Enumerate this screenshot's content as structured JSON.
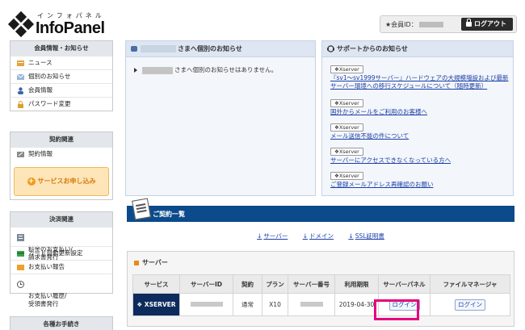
{
  "header": {
    "logo_kana": "インフォパネル",
    "logo_text": "InfoPanel",
    "member_id_label": "★会員ID：",
    "logout_label": "ログアウト"
  },
  "sidebar": {
    "section1": {
      "title": "会員情報・お知らせ",
      "items": [
        "ニュース",
        "個別のお知らせ",
        "会員情報",
        "パスワード変更"
      ]
    },
    "section2": {
      "title": "契約関連",
      "items": [
        "契約情報"
      ],
      "apply_label": "サービスお申し込み"
    },
    "section3": {
      "title": "決済関連",
      "items": [
        "料金のお支払い/\n請求書発行",
        "カード自動更新設定",
        "お支払い報告",
        "お支払い履歴/\n受領書発行"
      ]
    },
    "section4": {
      "title": "各種お手続き"
    }
  },
  "notice": {
    "title": "さまへ個別のお知らせ",
    "message": "さまへ個別のお知らせはありません。"
  },
  "support": {
    "title": "サポートからのお知らせ",
    "badge": "Xserver",
    "items": [
      "『sv1～sv1999サーバー』ハードウェアの大規模増設および最新サーバー環境への移行スケジュールについて（随時更新）",
      "国外からメールをご利用のお客様へ",
      "メール送信不能の件について",
      "サーバーにアクセスできなくなっている方へ",
      "ご登録メールアドレス再確認のお願い"
    ]
  },
  "contract": {
    "title": "ご契約一覧",
    "links": [
      "サーバー",
      "ドメイン",
      "SSL証明書"
    ],
    "server_section": "サーバー",
    "columns": [
      "サービス",
      "サーバーID",
      "契約",
      "プラン",
      "サーバー番号",
      "利用期限",
      "サーバーパネル",
      "ファイルマネージャ"
    ],
    "row": {
      "service": "XSERVER",
      "contract": "通常",
      "plan": "X10",
      "expiry": "2019-04-30",
      "panel_login": "ログイン",
      "fm_login": "ログイン"
    }
  },
  "colors": {
    "accent_bar": "#0b4a8b",
    "highlight": "#e6007e",
    "apply": "#f29a1a"
  }
}
